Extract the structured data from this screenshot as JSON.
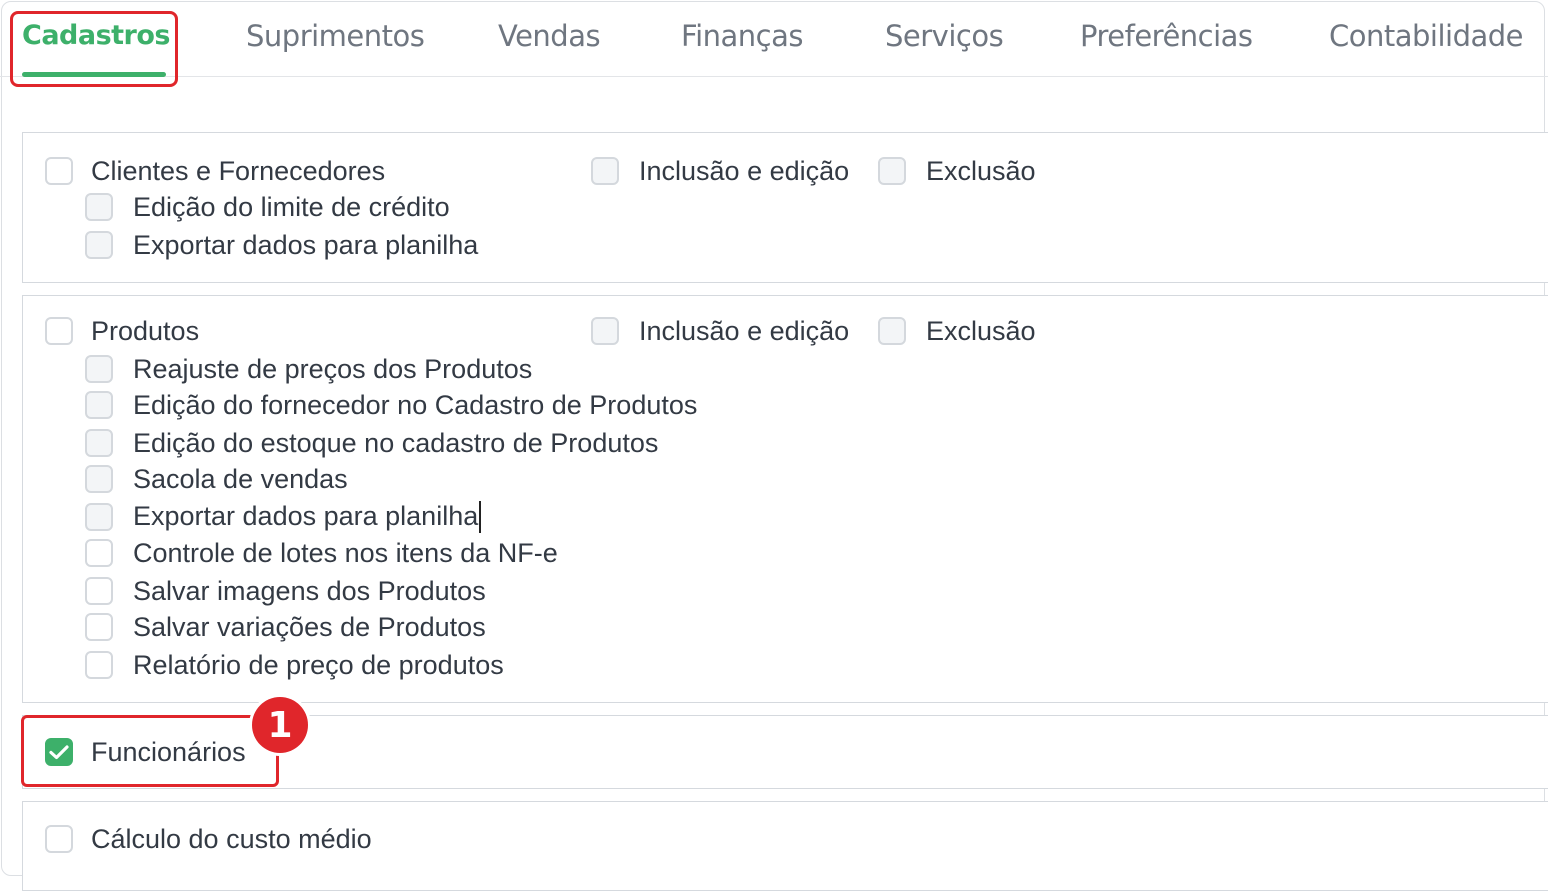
{
  "tabs": [
    {
      "label": "Cadastros",
      "active": true
    },
    {
      "label": "Suprimentos"
    },
    {
      "label": "Vendas"
    },
    {
      "label": "Finanças"
    },
    {
      "label": "Serviços"
    },
    {
      "label": "Preferências"
    },
    {
      "label": "Contabilidade"
    }
  ],
  "sections": {
    "clientes": {
      "main": "Clientes e Fornecedores",
      "inclusao": "Inclusão e edição",
      "exclusao": "Exclusão",
      "sub": [
        "Edição do limite de crédito",
        "Exportar dados para planilha"
      ]
    },
    "produtos": {
      "main": "Produtos",
      "inclusao": "Inclusão e edição",
      "exclusao": "Exclusão",
      "sub": [
        "Reajuste de preços dos Produtos",
        "Edição do fornecedor no Cadastro de Produtos",
        "Edição do estoque no cadastro de Produtos",
        "Sacola de vendas",
        "Exportar dados para planilha",
        "Controle de lotes nos itens da NF-e",
        "Salvar imagens dos Produtos",
        "Salvar variações de Produtos",
        "Relatório de preço de produtos"
      ]
    },
    "funcionarios": {
      "main": "Funcionários",
      "checked": true
    },
    "custo": {
      "main": "Cálculo do custo médio"
    }
  },
  "annotation": {
    "badge_number": "1"
  },
  "colors": {
    "accent": "#3db06a",
    "highlight": "#e0262b"
  }
}
